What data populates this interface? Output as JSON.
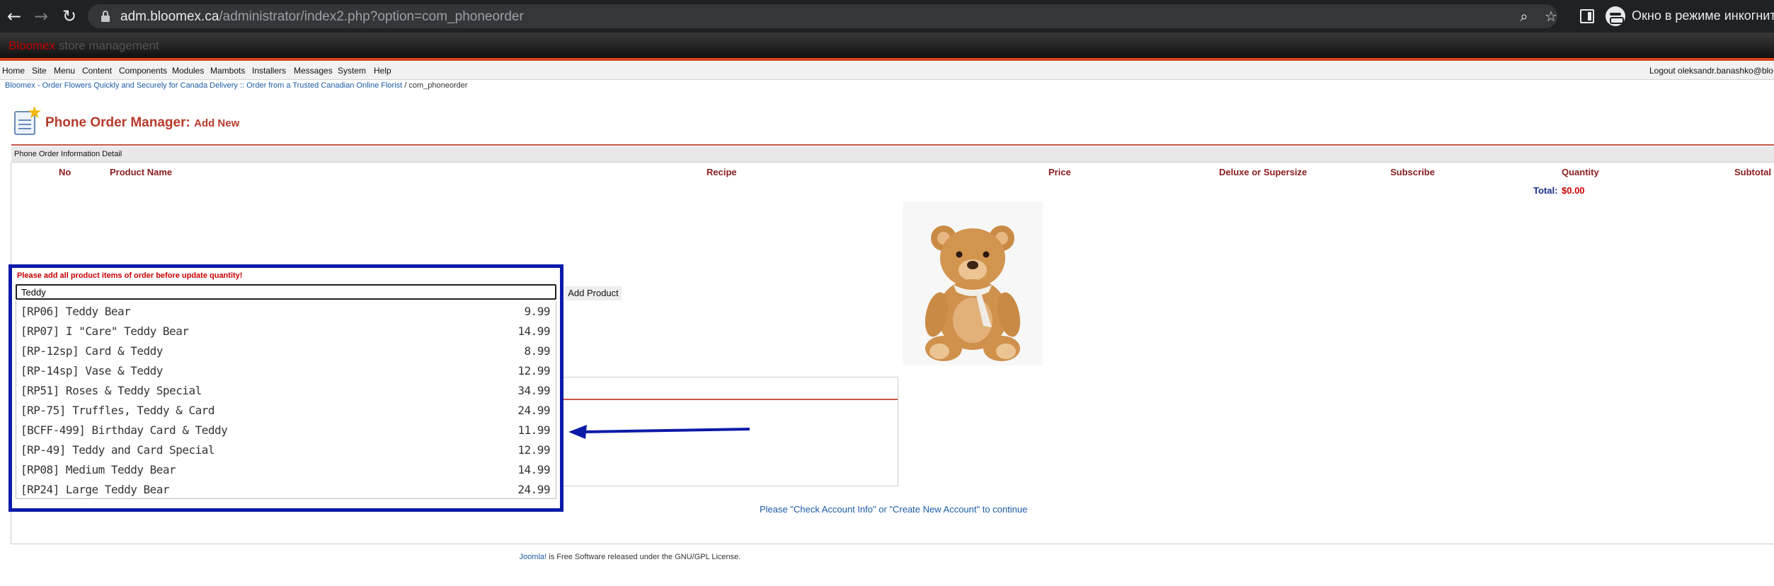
{
  "browser": {
    "url_host": "adm.bloomex.ca",
    "url_path": "/administrator/index2.php?option=com_phoneorder",
    "incognito_label": "Окно в режиме инкогнито"
  },
  "header": {
    "brand_name": "Bloomex",
    "brand_tagline": "store management",
    "accent_color": "#d64218"
  },
  "menu": {
    "items": [
      "Home",
      "Site",
      "Menu",
      "Content",
      "Components",
      "Modules",
      "Mambots",
      "Installers",
      "Messages",
      "System",
      "Help"
    ],
    "logout": "Logout oleksandr.banashko@blo"
  },
  "pathway": {
    "site_link": "Bloomex - Order Flowers Quickly and Securely for Canada Delivery :: Order from a Trusted Canadian Online Florist",
    "separator": " / ",
    "component": "com_phoneorder"
  },
  "page": {
    "title": "Phone Order Manager:",
    "subtitle": "Add New",
    "section": "Phone Order Information Detail"
  },
  "table": {
    "columns": [
      "No",
      "Product Name",
      "Recipe",
      "Price",
      "Deluxe or Supersize",
      "Subscribe",
      "Quantity",
      "Subtotal"
    ],
    "total_label": "Total:",
    "total_value": "$0.00"
  },
  "product_search": {
    "warning": "Please add all product items of order before update quantity!",
    "query": "Teddy",
    "add_button": "Add Product",
    "results": [
      {
        "name": "[RP06] Teddy Bear",
        "price": "9.99"
      },
      {
        "name": "[RP07] I \"Care\" Teddy Bear",
        "price": "14.99"
      },
      {
        "name": "[RP-12sp] Card & Teddy",
        "price": "8.99"
      },
      {
        "name": "[RP-14sp] Vase & Teddy",
        "price": "12.99"
      },
      {
        "name": "[RP51] Roses & Teddy Special",
        "price": "34.99"
      },
      {
        "name": "[RP-75] Truffles, Teddy & Card",
        "price": "24.99"
      },
      {
        "name": "[BCFF-499] Birthday Card & Teddy",
        "price": "11.99"
      },
      {
        "name": "[RP-49] Teddy and Card Special",
        "price": "12.99"
      },
      {
        "name": "[RP08] Medium Teddy Bear",
        "price": "14.99"
      },
      {
        "name": "[RP24] Large Teddy Bear",
        "price": "24.99"
      }
    ],
    "highlight_color": "#0c1aa8"
  },
  "continue_message": "Please \"Check Account Info\" or \"Create New Account\" to continue",
  "footer": {
    "link": "Joomla!",
    "text": " is Free Software released under the GNU/GPL License."
  }
}
